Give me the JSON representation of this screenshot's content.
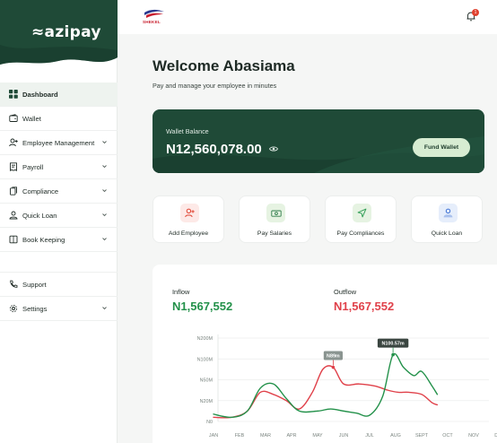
{
  "app": {
    "logo": "≈azipay",
    "brand_name": "SHEKEL",
    "notification_count": "1"
  },
  "sidebar": {
    "items": [
      {
        "label": "Dashboard",
        "icon": "grid-icon",
        "active": true,
        "chevron": false
      },
      {
        "label": "Wallet",
        "icon": "wallet-icon",
        "chevron": false
      },
      {
        "label": "Employee Management",
        "icon": "user-add-icon",
        "chevron": true
      },
      {
        "label": "Payroll",
        "icon": "receipt-icon",
        "chevron": true
      },
      {
        "label": "Compliance",
        "icon": "document-icon",
        "chevron": true
      },
      {
        "label": "Quick Loan",
        "icon": "loan-icon",
        "chevron": true
      },
      {
        "label": "Book Keeping",
        "icon": "book-icon",
        "chevron": true
      },
      {
        "label": "Support",
        "icon": "phone-icon",
        "chevron": false
      },
      {
        "label": "Settings",
        "icon": "gear-icon",
        "chevron": true
      }
    ]
  },
  "main": {
    "welcome": "Welcome Abasiama",
    "subtitle": "Pay and manage your employee in minutes",
    "wallet": {
      "label": "Wallet Balance",
      "amount": "N12,560,078.00",
      "fund_label": "Fund Wallet"
    },
    "actions": [
      {
        "label": "Add Employee",
        "icon": "user-add-icon",
        "bg": "#fde9e7",
        "fg": "#e0412f"
      },
      {
        "label": "Pay Salaries",
        "icon": "cash-icon",
        "bg": "#e6f3e2",
        "fg": "#2f7d4a"
      },
      {
        "label": "Pay Compliances",
        "icon": "send-icon",
        "bg": "#e6f3e2",
        "fg": "#2f9d55"
      },
      {
        "label": "Quick Loan",
        "icon": "loan-icon",
        "bg": "#e6eefb",
        "fg": "#3b6fd4"
      }
    ],
    "inflow": {
      "label": "Inflow",
      "value": "N1,567,552",
      "color": "#23914a"
    },
    "outflow": {
      "label": "Outflow",
      "value": "N1,567,552",
      "color": "#e0414a"
    }
  },
  "colors": {
    "brand_green": "#1f4a37",
    "inflow": "#23914a",
    "outflow": "#e0414a"
  },
  "chart_data": {
    "type": "line",
    "categories": [
      "JAN",
      "FEB",
      "MAR",
      "APR",
      "MAY",
      "JUN",
      "JUL",
      "AUG",
      "SEPT",
      "OCT",
      "NOV",
      "DEC"
    ],
    "y_ticks": [
      "N0",
      "N20M",
      "N50M",
      "N100M",
      "N200M"
    ],
    "y_tick_values": [
      0,
      1,
      2,
      3,
      4
    ],
    "ylim": [
      0,
      4
    ],
    "series": [
      {
        "name": "Inflow",
        "color": "#23914a",
        "x": [
          0,
          0.7,
          1.3,
          1.8,
          2.3,
          2.8,
          3.3,
          4.0,
          4.5,
          5.0,
          5.5,
          6.0,
          6.5,
          6.9,
          7.3,
          7.7,
          8.0,
          8.4,
          8.6
        ],
        "y": [
          0.35,
          0.2,
          0.5,
          1.6,
          1.8,
          1.1,
          0.5,
          0.5,
          0.6,
          0.5,
          0.4,
          0.3,
          1.2,
          3.2,
          2.6,
          2.2,
          2.4,
          1.7,
          1.3
        ]
      },
      {
        "name": "Outflow",
        "color": "#e0414a",
        "x": [
          0,
          0.7,
          1.3,
          1.8,
          2.3,
          2.8,
          3.3,
          3.8,
          4.2,
          4.6,
          5.0,
          5.6,
          6.2,
          6.7,
          7.1,
          7.5,
          8.0,
          8.4,
          8.6
        ],
        "y": [
          0.2,
          0.2,
          0.5,
          1.4,
          1.3,
          1.0,
          0.6,
          1.4,
          2.5,
          2.6,
          1.8,
          1.8,
          1.7,
          1.5,
          1.4,
          1.4,
          1.3,
          0.9,
          0.8
        ]
      }
    ],
    "annotations": [
      {
        "text": "N89m",
        "series": "Outflow",
        "x": 4.6,
        "y": 2.6
      },
      {
        "text": "N100.57m",
        "series": "Inflow",
        "x": 6.9,
        "y": 3.2
      }
    ]
  }
}
